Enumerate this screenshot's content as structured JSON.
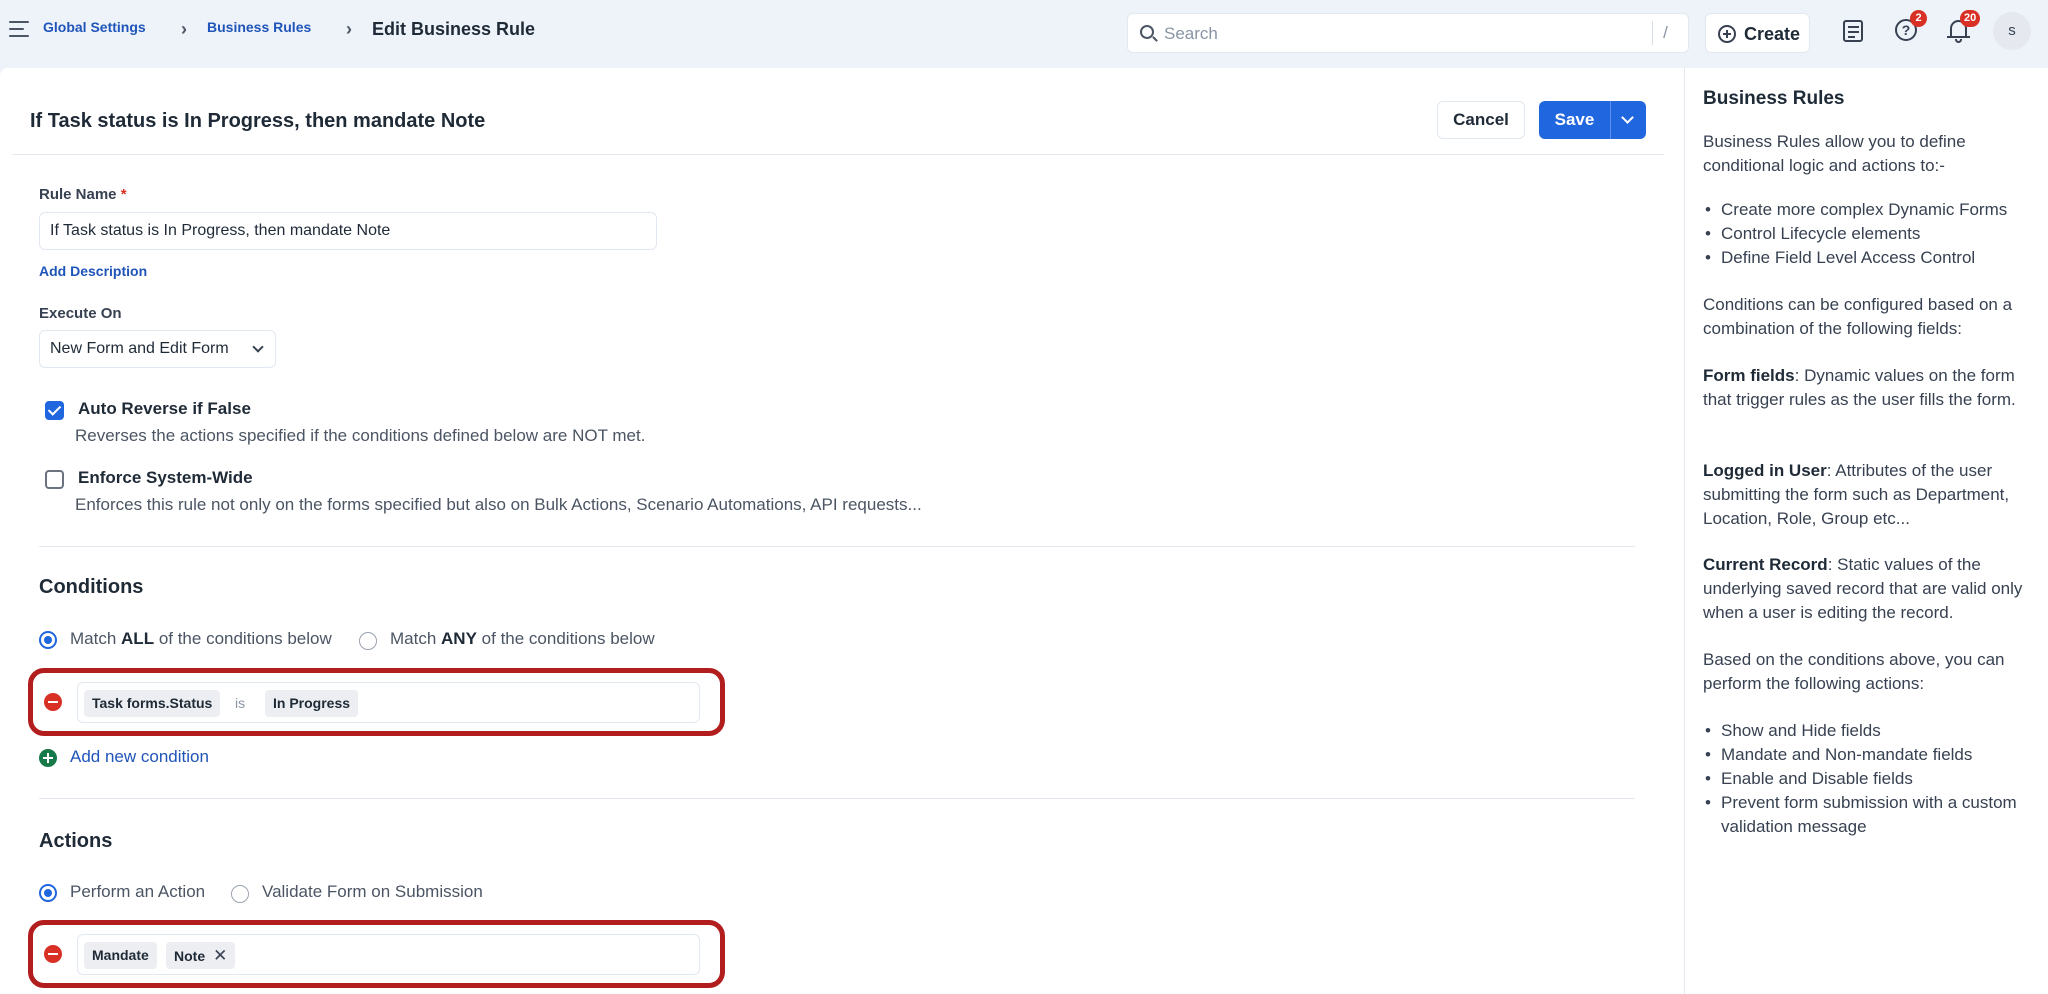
{
  "breadcrumb": {
    "items": [
      "Global Settings",
      "Business Rules"
    ],
    "current": "Edit Business Rule"
  },
  "search": {
    "placeholder": "Search",
    "shortcut": "/"
  },
  "header_actions": {
    "create_label": "Create",
    "help_badge": "2",
    "notifications_badge": "20",
    "avatar_initial": "s"
  },
  "form": {
    "title": "If Task status is In Progress, then mandate Note",
    "cancel_label": "Cancel",
    "save_label": "Save",
    "rule_name_label": "Rule Name",
    "rule_name_required": "*",
    "rule_name_value": "If Task status is In Progress, then mandate Note",
    "add_description_label": "Add Description",
    "execute_on_label": "Execute On",
    "execute_on_value": "New Form and Edit Form",
    "auto_reverse": {
      "checked": true,
      "title": "Auto Reverse if False",
      "description": "Reverses the actions specified if the conditions defined below are NOT met."
    },
    "enforce_system_wide": {
      "checked": false,
      "title": "Enforce System-Wide",
      "description": "Enforces this rule not only on the forms specified but also on Bulk Actions, Scenario Automations, API requests..."
    }
  },
  "conditions": {
    "title": "Conditions",
    "match_all_prefix": "Match",
    "match_all_strong": "ALL",
    "match_all_suffix": "of the conditions below",
    "match_any_prefix": "Match",
    "match_any_strong": "ANY",
    "match_any_suffix": "of the conditions below",
    "selected": "all",
    "rows": [
      {
        "field": "Task forms.Status",
        "operator": "is",
        "value": "In Progress"
      }
    ],
    "add_label": "Add new condition"
  },
  "actions": {
    "title": "Actions",
    "perform_label": "Perform an Action",
    "validate_label": "Validate Form on Submission",
    "selected": "perform",
    "rows": [
      {
        "action": "Mandate",
        "field": "Note",
        "remove_glyph": "✕"
      }
    ]
  },
  "help_panel": {
    "title": "Business Rules",
    "intro": "Business Rules allow you to define conditional logic and actions to:-",
    "uses": [
      "Create more complex Dynamic Forms",
      "Control Lifecycle elements",
      "Define Field Level Access Control"
    ],
    "conditions_intro": "Conditions can be configured based on a combination of the following fields:",
    "form_fields_term": "Form fields",
    "form_fields_desc": ": Dynamic values on the form that trigger rules as the user fills the form.",
    "logged_user_term": "Logged in User",
    "logged_user_desc": ": Attributes of the user submitting the form such as Department, Location, Role, Group etc...",
    "current_record_term": "Current Record",
    "current_record_desc": ": Static values of the underlying saved record that are valid only when a user is editing the record.",
    "actions_intro": "Based on the conditions above, you can perform the following actions:",
    "actions": [
      "Show and Hide fields",
      "Mandate and Non-mandate fields",
      "Enable and Disable fields",
      "Prevent form submission with a custom validation message"
    ]
  },
  "colors": {
    "primary": "#2066df",
    "link": "#1f54b8",
    "highlight_border": "#b21e1e",
    "remove": "#d93025",
    "add": "#16794a"
  }
}
